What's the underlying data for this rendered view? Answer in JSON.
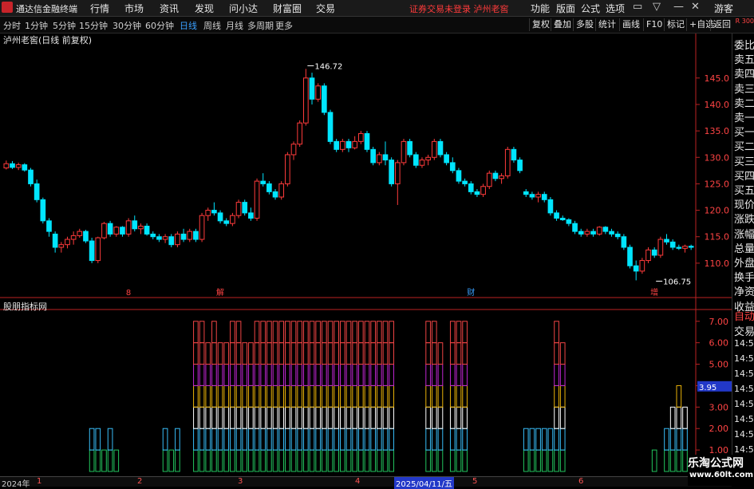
{
  "menubar": {
    "app_title": "通达信金融终端",
    "items": [
      "行情",
      "市场",
      "资讯",
      "发现",
      "问小达",
      "财富圈",
      "交易"
    ],
    "notice": "证券交易未登录  泸州老窖",
    "right_items": [
      "功能",
      "版面",
      "公式",
      "选项"
    ],
    "window_buttons": [
      "▭",
      "▽",
      "—",
      "✕"
    ]
  },
  "toolbar": {
    "periods": [
      "分时",
      "1分钟",
      "5分钟",
      "15分钟",
      "30分钟",
      "60分钟",
      "日线",
      "周线",
      "月线",
      "多周期",
      "更多"
    ],
    "active_period": "日线",
    "buttons": [
      "复权",
      "叠加",
      "多股",
      "统计",
      "画线",
      "F10",
      "标记",
      "+自选",
      "返回"
    ],
    "guest": "游客"
  },
  "chart_title": "泸州老窖(日线 前复权)",
  "rightpanel": {
    "corner": "R 300",
    "labels": [
      "委比",
      "卖五",
      "卖四",
      "卖三",
      "卖二",
      "卖一",
      "买一",
      "买二",
      "买三",
      "买四",
      "买五",
      "现价",
      "涨跌",
      "涨幅",
      "总量",
      "外盘",
      "换手",
      "净资",
      "收益"
    ],
    "lower_labels": [
      "自动",
      "交易",
      "14:56",
      "14:56",
      "14:56",
      "14:56",
      "14:56",
      "14:56",
      "14:56",
      "14:56"
    ]
  },
  "indicator_title": "股朋指标网",
  "chart_data": [
    {
      "type": "candlestick",
      "title": "泸州老窖(日线 前复权)",
      "y_ticks": [
        145.0,
        140.0,
        135.0,
        130.0,
        125.0,
        120.0,
        115.0,
        110.0
      ],
      "ylim": [
        103.5,
        151.0
      ],
      "annotations": [
        {
          "label": "146.72",
          "value": 146.72,
          "bar": 49
        },
        {
          "label": "106.75",
          "value": 106.75,
          "bar": 106
        }
      ],
      "event_markers": [
        {
          "label": "8",
          "bar": 20
        },
        {
          "label": "解",
          "bar": 35
        },
        {
          "label": "财",
          "bar": 76
        },
        {
          "label": "增",
          "bar": 106
        }
      ],
      "ohlc": [
        [
          128.0,
          129.4,
          127.7,
          128.8
        ],
        [
          128.8,
          129.3,
          127.8,
          128.1
        ],
        [
          128.1,
          129.0,
          127.6,
          128.6
        ],
        [
          128.6,
          128.9,
          127.3,
          127.6
        ],
        [
          127.6,
          128.0,
          124.5,
          125.0
        ],
        [
          125.0,
          125.8,
          121.5,
          122.0
        ],
        [
          122.0,
          122.4,
          117.5,
          118.0
        ],
        [
          118.0,
          118.5,
          115.0,
          116.0
        ],
        [
          115.5,
          116.0,
          112.0,
          113.0
        ],
        [
          113.0,
          114.0,
          112.0,
          113.5
        ],
        [
          113.5,
          115.0,
          112.8,
          114.5
        ],
        [
          114.5,
          116.0,
          113.5,
          115.2
        ],
        [
          115.2,
          116.5,
          114.8,
          116.0
        ],
        [
          116.0,
          116.3,
          113.8,
          114.2
        ],
        [
          114.2,
          114.8,
          110.0,
          110.5
        ],
        [
          110.5,
          115.0,
          110.0,
          114.8
        ],
        [
          114.8,
          117.8,
          114.5,
          117.5
        ],
        [
          117.5,
          118.0,
          115.0,
          115.5
        ],
        [
          115.5,
          117.0,
          115.0,
          116.8
        ],
        [
          116.8,
          117.0,
          115.0,
          115.5
        ],
        [
          115.5,
          118.5,
          115.0,
          118.0
        ],
        [
          118.0,
          119.0,
          116.0,
          116.5
        ],
        [
          116.5,
          117.5,
          115.5,
          117.0
        ],
        [
          117.0,
          117.5,
          115.2,
          115.5
        ],
        [
          115.5,
          116.0,
          114.5,
          115.0
        ],
        [
          115.0,
          115.5,
          114.0,
          114.5
        ],
        [
          114.5,
          115.5,
          113.8,
          115.0
        ],
        [
          115.0,
          115.5,
          113.0,
          113.5
        ],
        [
          113.5,
          116.0,
          113.0,
          115.5
        ],
        [
          115.5,
          116.5,
          114.0,
          114.5
        ],
        [
          114.5,
          116.5,
          114.0,
          116.0
        ],
        [
          116.0,
          116.5,
          114.0,
          114.5
        ],
        [
          114.5,
          119.5,
          114.0,
          119.0
        ],
        [
          119.0,
          120.5,
          118.0,
          120.0
        ],
        [
          120.0,
          121.5,
          119.0,
          119.5
        ],
        [
          119.5,
          120.0,
          117.5,
          118.0
        ],
        [
          118.0,
          118.5,
          117.0,
          117.5
        ],
        [
          117.5,
          119.5,
          117.0,
          119.0
        ],
        [
          119.0,
          122.0,
          118.5,
          121.5
        ],
        [
          121.5,
          122.0,
          119.0,
          119.5
        ],
        [
          119.5,
          120.5,
          118.0,
          118.5
        ],
        [
          118.5,
          126.0,
          118.0,
          125.5
        ],
        [
          125.5,
          127.0,
          124.5,
          125.0
        ],
        [
          125.0,
          125.5,
          123.0,
          123.5
        ],
        [
          123.5,
          124.0,
          122.0,
          122.5
        ],
        [
          122.5,
          125.5,
          122.0,
          125.0
        ],
        [
          125.0,
          131.0,
          124.5,
          130.5
        ],
        [
          130.5,
          133.0,
          129.5,
          132.5
        ],
        [
          132.5,
          137.0,
          132.0,
          136.5
        ],
        [
          136.5,
          146.72,
          136.0,
          145.0
        ],
        [
          145.0,
          146.0,
          140.0,
          141.0
        ],
        [
          141.0,
          144.0,
          140.5,
          143.5
        ],
        [
          143.5,
          144.0,
          138.0,
          138.5
        ],
        [
          138.5,
          139.0,
          132.5,
          133.0
        ],
        [
          133.0,
          133.5,
          131.0,
          131.5
        ],
        [
          131.5,
          133.5,
          131.0,
          133.0
        ],
        [
          133.0,
          133.5,
          131.0,
          131.8
        ],
        [
          131.8,
          134.0,
          131.5,
          133.0
        ],
        [
          133.0,
          135.0,
          132.5,
          134.5
        ],
        [
          134.5,
          135.0,
          131.0,
          131.5
        ],
        [
          131.5,
          132.0,
          128.5,
          129.0
        ],
        [
          129.0,
          131.0,
          128.5,
          130.5
        ],
        [
          130.5,
          133.0,
          128.5,
          129.5
        ],
        [
          129.5,
          130.0,
          124.5,
          125.0
        ],
        [
          125.0,
          129.5,
          121.0,
          129.0
        ],
        [
          129.0,
          133.5,
          128.5,
          133.0
        ],
        [
          133.0,
          133.5,
          130.0,
          130.5
        ],
        [
          130.5,
          131.0,
          128.0,
          128.5
        ],
        [
          128.5,
          130.0,
          128.0,
          129.5
        ],
        [
          129.5,
          130.5,
          128.5,
          130.0
        ],
        [
          130.0,
          133.5,
          129.5,
          133.0
        ],
        [
          133.0,
          133.5,
          130.0,
          130.5
        ],
        [
          130.5,
          131.0,
          128.5,
          129.0
        ],
        [
          129.0,
          130.0,
          127.0,
          127.5
        ],
        [
          127.5,
          128.0,
          125.0,
          125.5
        ],
        [
          125.5,
          126.0,
          124.5,
          125.0
        ],
        [
          125.0,
          125.5,
          123.0,
          123.5
        ],
        [
          123.5,
          124.0,
          122.5,
          123.0
        ],
        [
          123.0,
          125.0,
          122.5,
          124.5
        ],
        [
          124.5,
          127.5,
          124.0,
          127.0
        ],
        [
          127.0,
          127.5,
          125.5,
          126.0
        ],
        [
          126.0,
          127.0,
          125.0,
          126.5
        ],
        [
          126.5,
          132.0,
          126.0,
          131.5
        ],
        [
          131.5,
          132.0,
          129.0,
          129.5
        ],
        [
          129.5,
          130.0,
          127.0,
          127.5
        ],
        [
          123.5,
          124.0,
          122.5,
          123.0
        ],
        [
          123.0,
          123.5,
          122.0,
          122.5
        ],
        [
          122.5,
          123.5,
          121.5,
          123.0
        ],
        [
          123.0,
          123.5,
          121.5,
          122.0
        ],
        [
          122.0,
          122.5,
          119.0,
          119.5
        ],
        [
          119.5,
          120.0,
          118.0,
          118.5
        ],
        [
          118.5,
          119.0,
          118.0,
          118.2
        ],
        [
          118.2,
          118.5,
          117.0,
          117.5
        ],
        [
          117.5,
          118.0,
          115.5,
          116.0
        ],
        [
          116.0,
          116.5,
          115.0,
          115.5
        ],
        [
          115.5,
          116.5,
          115.0,
          116.0
        ],
        [
          116.0,
          116.5,
          115.0,
          115.5
        ],
        [
          115.5,
          117.0,
          115.2,
          116.8
        ],
        [
          116.8,
          117.0,
          115.5,
          116.0
        ],
        [
          116.0,
          116.5,
          115.0,
          115.5
        ],
        [
          115.5,
          116.0,
          114.5,
          115.0
        ],
        [
          115.0,
          115.5,
          112.5,
          113.0
        ],
        [
          113.0,
          113.5,
          109.0,
          109.5
        ],
        [
          109.5,
          110.5,
          106.75,
          108.5
        ],
        [
          108.5,
          111.0,
          108.0,
          110.5
        ],
        [
          110.5,
          113.0,
          110.0,
          112.5
        ],
        [
          112.5,
          113.0,
          111.0,
          111.5
        ],
        [
          111.5,
          115.0,
          111.0,
          114.5
        ],
        [
          114.5,
          115.5,
          113.5,
          114.0
        ],
        [
          114.0,
          114.5,
          112.5,
          113.0
        ],
        [
          113.0,
          113.5,
          112.5,
          112.8
        ],
        [
          112.8,
          113.5,
          112.0,
          113.2
        ],
        [
          113.2,
          113.5,
          112.5,
          113.0
        ]
      ]
    },
    {
      "type": "bar",
      "title": "股朋指标网",
      "y_ticks": [
        7.0,
        6.0,
        5.0,
        4.0,
        3.0,
        2.0,
        1.0
      ],
      "ylim": [
        0,
        7.4
      ],
      "current_value": "3.95",
      "series_colors": [
        "#22c55e",
        "#38bdf8",
        "#ffffff",
        "#eab308",
        "#c026d3",
        "#ef4444"
      ],
      "values": [
        0,
        0,
        0,
        0,
        0,
        0,
        0,
        0,
        0,
        0,
        0,
        0,
        0,
        0,
        2,
        2,
        1,
        2,
        1,
        0,
        0,
        0,
        0,
        0,
        0,
        0,
        2,
        1,
        2,
        0,
        0,
        7,
        7,
        6,
        7,
        6,
        6,
        7,
        7,
        6,
        6,
        7,
        7,
        7,
        7,
        7,
        7,
        7,
        7,
        7,
        7,
        7,
        7,
        7,
        7,
        7,
        7,
        7,
        7,
        7,
        7,
        7,
        7,
        7,
        0,
        0,
        0,
        0,
        0,
        7,
        7,
        6,
        0,
        7,
        7,
        7,
        0,
        0,
        0,
        0,
        0,
        0,
        0,
        0,
        0,
        2,
        2,
        2,
        2,
        2,
        7,
        6,
        0,
        0,
        0,
        0,
        0,
        0,
        0,
        0,
        0,
        0,
        0,
        0,
        0,
        0,
        1,
        0,
        2,
        3,
        4,
        3,
        0
      ]
    }
  ],
  "datebar": {
    "labels": [
      "2024年",
      "1",
      "2",
      "3",
      "4",
      "2025/04/11/五",
      "5",
      "6"
    ]
  },
  "watermark": {
    "line1": "乐淘公式网",
    "line2": "www.60lt.com"
  }
}
